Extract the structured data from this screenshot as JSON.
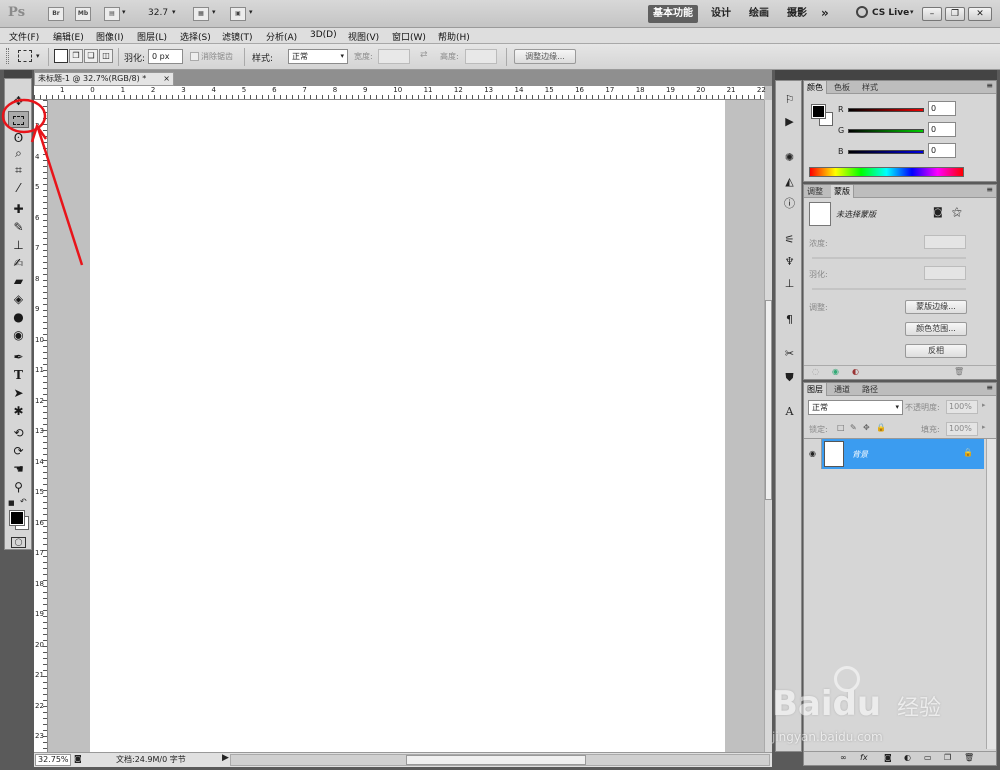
{
  "appbar": {
    "logo": "Ps",
    "br": "Br",
    "mb": "Mb",
    "zoom": "32.7",
    "workspaces": [
      "基本功能",
      "设计",
      "绘画",
      "摄影"
    ],
    "more": "»",
    "cslive": "CS Live"
  },
  "menu": [
    "文件(F)",
    "编辑(E)",
    "图像(I)",
    "图层(L)",
    "选择(S)",
    "滤镜(T)",
    "分析(A)",
    "3D(D)",
    "视图(V)",
    "窗口(W)",
    "帮助(H)"
  ],
  "options": {
    "feather_label": "羽化:",
    "feather_value": "0 px",
    "antialias": "消除锯齿",
    "style_label": "样式:",
    "style_value": "正常",
    "width_label": "宽度:",
    "height_label": "高度:",
    "refine_edge": "调整边缘..."
  },
  "document": {
    "tab": "未标题-1 @ 32.7%(RGB/8) *",
    "ruler_top": [
      "1",
      "0",
      "1",
      "2",
      "3",
      "4",
      "5",
      "6",
      "7",
      "8",
      "9",
      "10",
      "11",
      "12",
      "13",
      "14",
      "15",
      "16",
      "17",
      "18",
      "19",
      "20",
      "21",
      "22"
    ],
    "ruler_left": [
      "3",
      "4",
      "5",
      "6",
      "7",
      "8",
      "9",
      "10",
      "11",
      "12",
      "13",
      "14",
      "15",
      "16",
      "17",
      "18",
      "19",
      "20",
      "21",
      "22",
      "23"
    ]
  },
  "status": {
    "zoom": "32.75%",
    "doc": "文档:24.9M/0 字节"
  },
  "color_panel": {
    "tabs": [
      "颜色",
      "色板",
      "样式"
    ],
    "r_label": "R",
    "g_label": "G",
    "b_label": "B",
    "r": "0",
    "g": "0",
    "b": "0"
  },
  "masks_panel": {
    "tabs": [
      "调整",
      "蒙版"
    ],
    "no_mask": "未选择蒙版",
    "density": "浓度:",
    "feather": "羽化:",
    "refine": "调整:",
    "mask_edge": "蒙版边缘...",
    "color_range": "颜色范围...",
    "invert": "反相"
  },
  "layers_panel": {
    "tabs": [
      "图层",
      "通道",
      "路径"
    ],
    "blend": "正常",
    "opacity_label": "不透明度:",
    "opacity": "100%",
    "lock_label": "锁定:",
    "fill_label": "填充:",
    "fill": "100%",
    "layer_name": "背景"
  },
  "colors": {
    "accent": "#3b9cf0",
    "annotation": "#e8141a"
  },
  "watermark": {
    "brand": "Baidu",
    "cn": "经验",
    "url": "jingyan.baidu.com"
  }
}
